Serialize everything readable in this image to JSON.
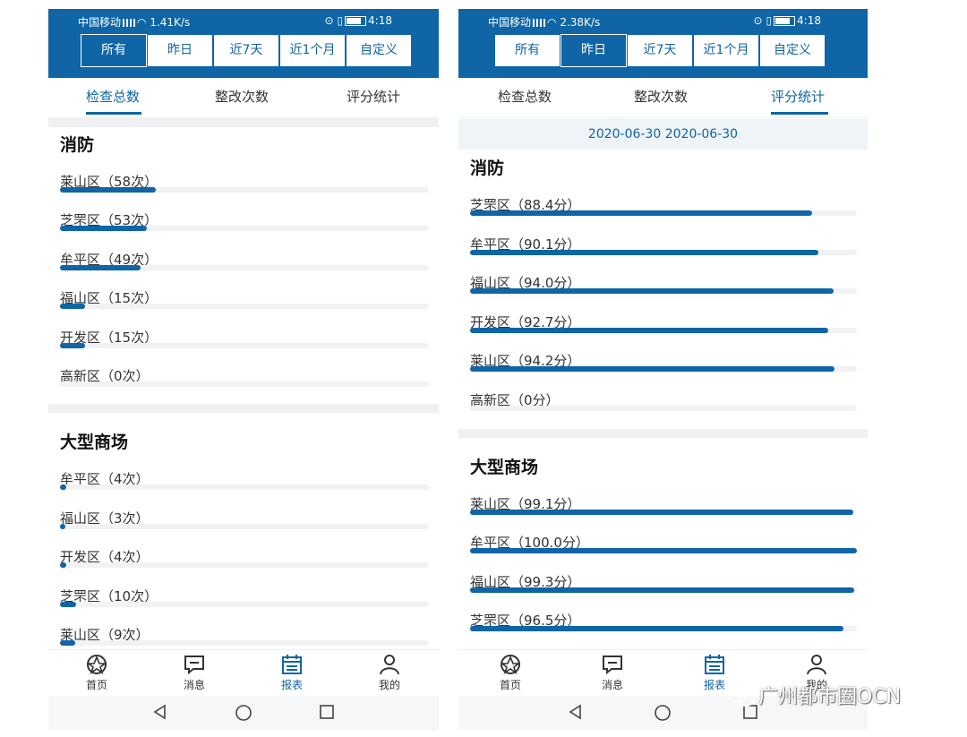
{
  "left": {
    "status": {
      "carrier": "中国移动",
      "speed": "1.41K/s",
      "time": "4:18"
    },
    "filters": [
      "所有",
      "昨日",
      "近7天",
      "近1个月",
      "自定义"
    ],
    "tabs": [
      "检查总数",
      "整改次数",
      "评分统计"
    ],
    "sections": [
      {
        "title": "消防",
        "items": [
          {
            "label": "莱山区（58次）",
            "value": 58
          },
          {
            "label": "芝罘区（53次）",
            "value": 53
          },
          {
            "label": "牟平区（49次）",
            "value": 49
          },
          {
            "label": "福山区（15次）",
            "value": 15
          },
          {
            "label": "开发区（15次）",
            "value": 15
          },
          {
            "label": "高新区（0次）",
            "value": 0
          }
        ]
      },
      {
        "title": "大型商场",
        "items": [
          {
            "label": "牟平区（4次）",
            "value": 4
          },
          {
            "label": "福山区（3次）",
            "value": 3
          },
          {
            "label": "开发区（4次）",
            "value": 4
          },
          {
            "label": "芝罘区（10次）",
            "value": 10
          },
          {
            "label": "莱山区（9次）",
            "value": 9
          }
        ]
      }
    ],
    "nav": [
      "首页",
      "消息",
      "报表",
      "我的"
    ]
  },
  "right": {
    "status": {
      "carrier": "中国移动",
      "speed": "2.38K/s",
      "time": "4:18"
    },
    "filters": [
      "所有",
      "昨日",
      "近7天",
      "近1个月",
      "自定义"
    ],
    "tabs": [
      "检查总数",
      "整改次数",
      "评分统计"
    ],
    "date_range": "2020-06-30  2020-06-30",
    "sections": [
      {
        "title": "消防",
        "items": [
          {
            "label": "芝罘区（88.4分）",
            "value": 88.4
          },
          {
            "label": "牟平区（90.1分）",
            "value": 90.1
          },
          {
            "label": "福山区（94.0分）",
            "value": 94.0
          },
          {
            "label": "开发区（92.7分）",
            "value": 92.7
          },
          {
            "label": "莱山区（94.2分）",
            "value": 94.2
          },
          {
            "label": "高新区（0分）",
            "value": 0
          }
        ]
      },
      {
        "title": "大型商场",
        "items": [
          {
            "label": "莱山区（99.1分）",
            "value": 99.1
          },
          {
            "label": "牟平区（100.0分）",
            "value": 100.0
          },
          {
            "label": "福山区（99.3分）",
            "value": 99.3
          },
          {
            "label": "芝罘区（96.5分）",
            "value": 96.5
          }
        ]
      }
    ],
    "nav": [
      "首页",
      "消息",
      "报表",
      "我的"
    ]
  },
  "watermark": "广州都市圈OCN",
  "colors": {
    "accent": "#0f65a6",
    "track": "#f0f2f4"
  }
}
